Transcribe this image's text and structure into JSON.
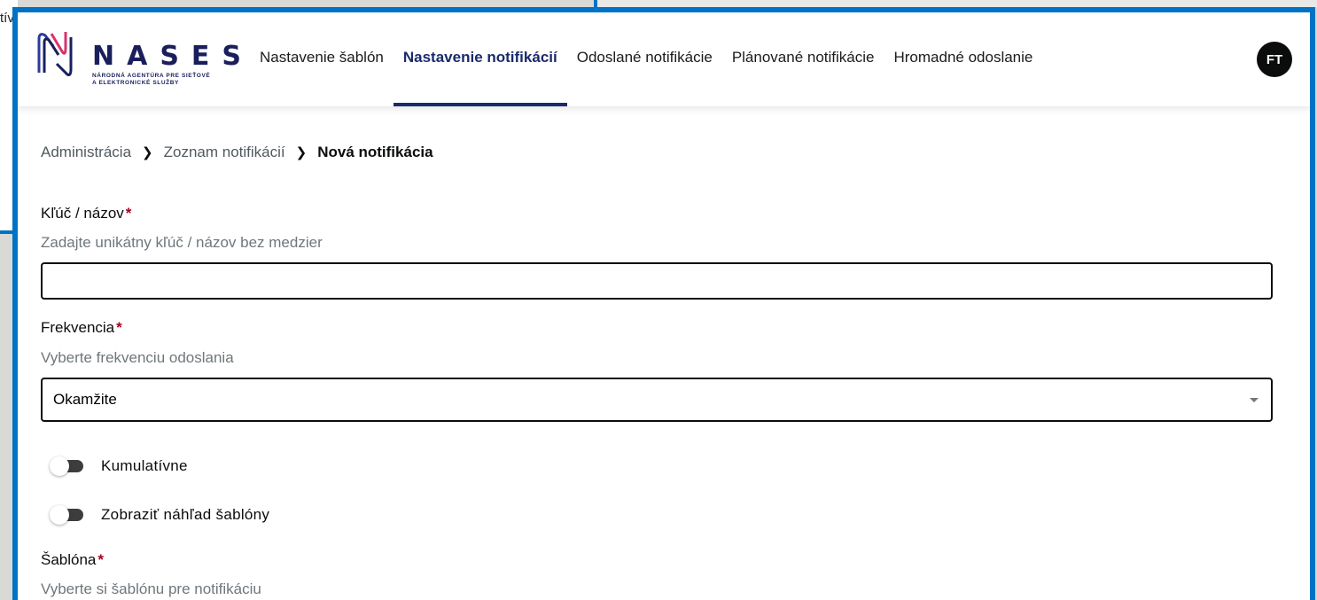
{
  "background": {
    "left_fragment_text": "tív"
  },
  "header": {
    "logo": {
      "wordmark": "NASES",
      "subtitle_line1": "NÁRODNÁ AGENTÚRA PRE SIEŤOVÉ",
      "subtitle_line2": "A ELEKTRONICKÉ SLUŽBY",
      "colors": {
        "primary": "#1a1f5c",
        "accent": "#d6336c"
      }
    },
    "nav": [
      {
        "label": "Nastavenie šablón",
        "active": false
      },
      {
        "label": "Nastavenie notifikácií",
        "active": true
      },
      {
        "label": "Odoslané notifikácie",
        "active": false
      },
      {
        "label": "Plánované notifikácie",
        "active": false
      },
      {
        "label": "Hromadné odoslanie",
        "active": false
      }
    ],
    "avatar_initials": "FT"
  },
  "breadcrumb": {
    "items": [
      "Administrácia",
      "Zoznam notifikácií"
    ],
    "current": "Nová notifikácia"
  },
  "form": {
    "key": {
      "label": "Kľúč / názov",
      "required_mark": "*",
      "hint": "Zadajte unikátny kľúč / názov bez medzier",
      "value": ""
    },
    "frequency": {
      "label": "Frekvencia",
      "required_mark": "*",
      "hint": "Vyberte frekvenciu odoslania",
      "selected": "Okamžite"
    },
    "toggles": [
      {
        "label": "Kumulatívne",
        "on": false
      },
      {
        "label": "Zobraziť náhľad šablóny",
        "on": false
      }
    ],
    "template": {
      "label": "Šablóna",
      "required_mark": "*",
      "hint": "Vyberte si šablónu pre notifikáciu"
    }
  },
  "colors": {
    "frame_border": "#0072c6",
    "active_nav": "#1a2a6c",
    "required": "#a4001d"
  }
}
